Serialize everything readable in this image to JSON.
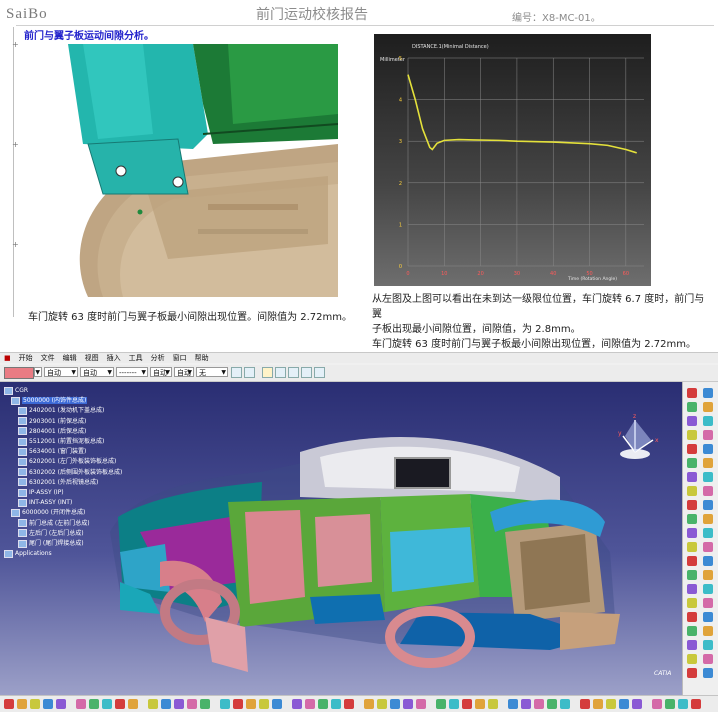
{
  "doc": {
    "brand": "SaiBo",
    "title": "前门运动校核报告",
    "code": "编号：X8-MC-01。",
    "section_title": "前门与翼子板运动间隙分析。",
    "caption_left": "车门旋转 63 度时前门与翼子板最小间隙出现位置。间隙值为 2.72mm。",
    "note_line1": "从左图及上图可以看出在未到达一级限位位置，车门旋转 6.7 度时，前门与翼",
    "note_line2": "子板出现最小间隙位置，间隙值，为 2.8mm。",
    "note_line3": "车门旋转 63 度时前门与翼子板最小间隙出现位置，间隙值为 2.72mm。"
  },
  "graph": {
    "header": "DISTANCE.1(Minimal Distance)",
    "y_unit": "Millimeter",
    "x_unit": "Time (Rotation Angle)"
  },
  "chart_data": {
    "type": "line",
    "title": "DISTANCE.1(Minimal Distance)",
    "ylabel": "Millimeter",
    "xlabel": "",
    "series": [
      {
        "name": "DISTANCE.1(Minimal Distance)",
        "x": [
          0,
          2,
          4,
          6,
          6.7,
          8,
          10,
          14,
          18,
          25,
          30,
          40,
          50,
          55,
          60,
          63
        ],
        "y": [
          4.6,
          4.0,
          3.3,
          2.85,
          2.8,
          2.95,
          3.02,
          3.04,
          3.03,
          3.02,
          3.0,
          2.98,
          2.94,
          2.9,
          2.8,
          2.72
        ]
      }
    ],
    "xlim": [
      0,
      65
    ],
    "ylim": [
      0,
      5
    ],
    "grid": true,
    "line_color": "#e4e13b"
  },
  "app": {
    "menu": [
      "开始",
      "文件",
      "编辑",
      "视图",
      "插入",
      "工具",
      "分析",
      "窗口",
      "帮助"
    ],
    "fmt": {
      "dd1": "自动",
      "dd2": "自动",
      "dd3": "-------",
      "dd4": "自动",
      "dd5": "自动",
      "dd6": "无"
    },
    "tree": [
      {
        "label": "CGR",
        "level": 0,
        "selected": false
      },
      {
        "label": "5000000 (内饰件总成)",
        "level": 1,
        "selected": true
      },
      {
        "label": "2402001 (发动机下盖总成)",
        "level": 2,
        "selected": false
      },
      {
        "label": "2903001 (前保总成)",
        "level": 2,
        "selected": false
      },
      {
        "label": "2804001 (后保总成)",
        "level": 2,
        "selected": false
      },
      {
        "label": "5512001 (前置挡泥板总成)",
        "level": 2,
        "selected": false
      },
      {
        "label": "5634001 (窗门装置)",
        "level": 2,
        "selected": false
      },
      {
        "label": "6202001 (左门外板装饰板总成)",
        "level": 2,
        "selected": false
      },
      {
        "label": "6302002 (后侧围外板装饰板总成)",
        "level": 2,
        "selected": false
      },
      {
        "label": "6302001 (外后视镜总成)",
        "level": 2,
        "selected": false
      },
      {
        "label": "IP-ASSY (IP)",
        "level": 2,
        "selected": false
      },
      {
        "label": "INT-ASSY (INT)",
        "level": 2,
        "selected": false
      },
      {
        "label": "6000000 (开闭件总成)",
        "level": 1,
        "selected": false
      },
      {
        "label": "前门总成 (左前门总成)",
        "level": 2,
        "selected": false
      },
      {
        "label": "左后门 (左后门总成)",
        "level": 2,
        "selected": false
      },
      {
        "label": "尾门 (尾门焊接总成)",
        "level": 2,
        "selected": false
      },
      {
        "label": "Applications",
        "level": 0,
        "selected": false
      }
    ],
    "logo": "CATIA"
  }
}
